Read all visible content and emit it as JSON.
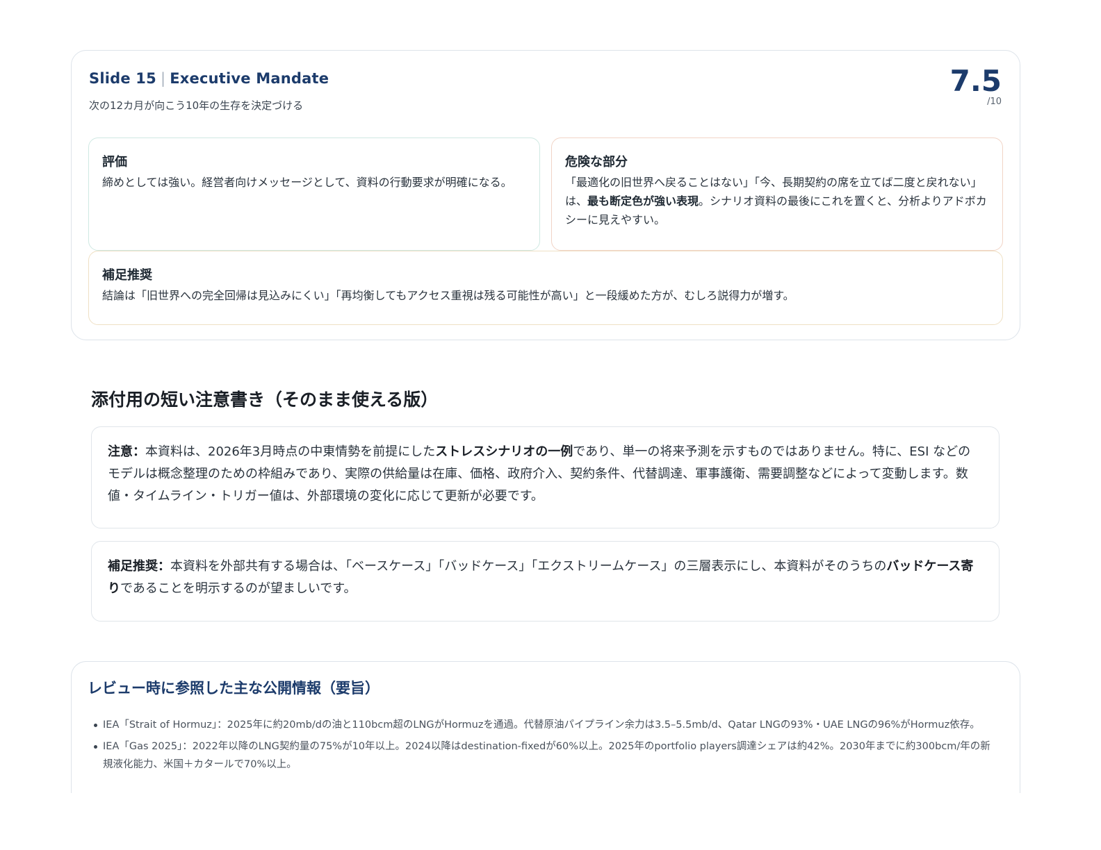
{
  "slide": {
    "number": "Slide 15",
    "separator": "|",
    "title": "Executive Mandate",
    "subtitle": "次の12カ月が向こう10年の生存を決定づける",
    "score": "7.5",
    "score_max": "/10"
  },
  "evaluation": {
    "label": "評価",
    "text": "締めとしては強い。経営者向けメッセージとして、資料の行動要求が明確になる。"
  },
  "danger": {
    "label": "危険な部分",
    "text_before": "「最適化の旧世界へ戻ることはない」「今、長期契約の席を立てば二度と戻れない」は、",
    "text_bold": "最も断定色が強い表現",
    "text_after": "。シナリオ資料の最後にこれを置くと、分析よりアドボカシーに見えやすい。"
  },
  "supplement": {
    "label": "補足推奨",
    "text": "結論は「旧世界への完全回帰は見込みにくい」「再均衡してもアクセス重視は残る可能性が高い」と一段緩めた方が、むしろ説得力が増す。"
  },
  "notes_section": {
    "title": "添付用の短い注意書き（そのまま使える版）",
    "note1": {
      "label": "注意：",
      "text_before": "本資料は、2026年3月時点の中東情勢を前提にした",
      "text_bold": "ストレスシナリオの一例",
      "text_after": "であり、単一の将来予測を示すものではありません。特に、ESI などのモデルは概念整理のための枠組みであり、実際の供給量は在庫、価格、政府介入、契約条件、代替調達、軍事護衛、需要調整などによって変動します。数値・タイムライン・トリガー値は、外部環境の変化に応じて更新が必要です。"
    },
    "note2": {
      "label": "補足推奨：",
      "text_before": "本資料を外部共有する場合は、「ベースケース」「バッドケース」「エクストリームケース」の三層表示にし、本資料がそのうちの",
      "text_bold": "バッドケース寄り",
      "text_after": "であることを明示するのが望ましいです。"
    }
  },
  "references": {
    "title": "レビュー時に参照した主な公開情報（要旨）",
    "items": [
      "IEA「Strait of Hormuz」：2025年に約20mb/dの油と110bcm超のLNGがHormuzを通過。代替原油パイプライン余力は3.5–5.5mb/d、Qatar LNGの93%・UAE LNGの96%がHormuz依存。",
      "IEA「Gas 2025」：2022年以降のLNG契約量の75%が10年以上。2024以降はdestination-fixedが60%以上。2025年のportfolio players調達シェアは約42%。2030年までに約300bcm/年の新規液化能力、米国＋カタールで70%以上。"
    ]
  },
  "colors": {
    "accent": "#1c3b6b",
    "eval_border": "#cfe8e2",
    "danger_border": "#f1d4c6",
    "supp_border": "#efe0c4"
  }
}
